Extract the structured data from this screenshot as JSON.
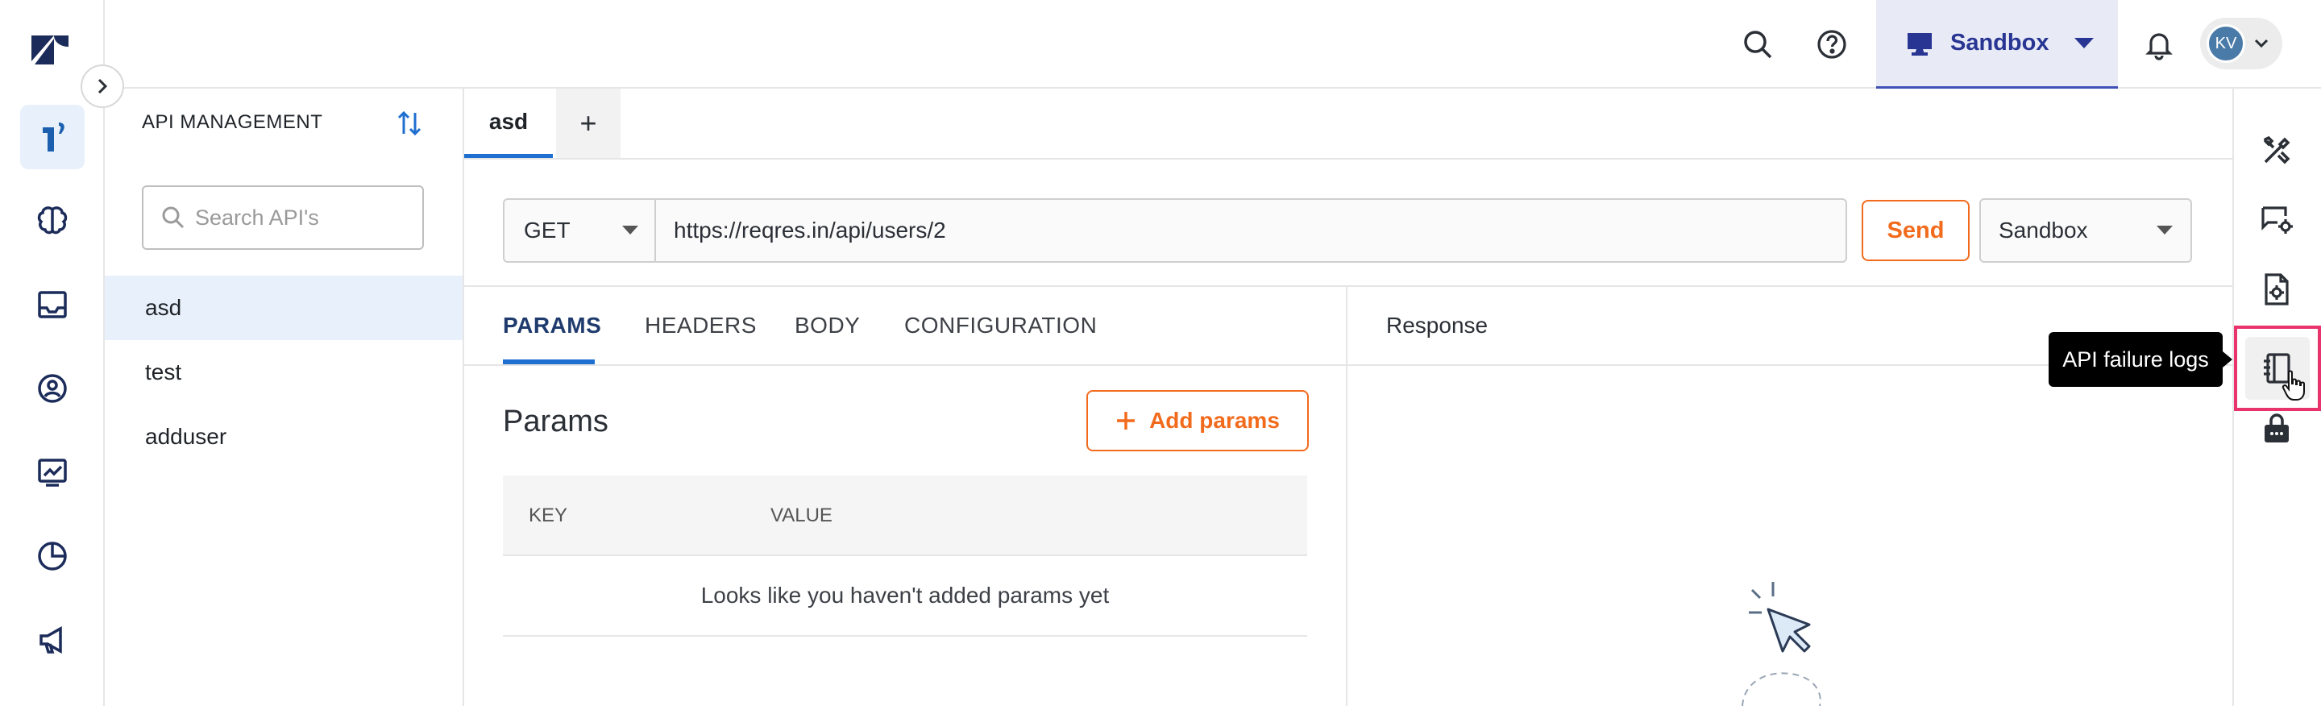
{
  "topbar": {
    "environment_label": "Sandbox",
    "avatar_initials": "KV"
  },
  "api_panel": {
    "title": "API MANAGEMENT",
    "search_placeholder": "Search API's",
    "items": [
      {
        "label": "asd",
        "selected": true
      },
      {
        "label": "test",
        "selected": false
      },
      {
        "label": "adduser",
        "selected": false
      }
    ]
  },
  "tabs": {
    "items": [
      {
        "label": "asd"
      }
    ],
    "add_label": "+"
  },
  "request": {
    "method": "GET",
    "url": "https://reqres.in/api/users/2",
    "send_label": "Send",
    "environment": "Sandbox"
  },
  "subtabs": [
    "PARAMS",
    "HEADERS",
    "BODY",
    "CONFIGURATION"
  ],
  "params": {
    "title": "Params",
    "add_label": "Add params",
    "col_key": "KEY",
    "col_value": "VALUE",
    "empty_text": "Looks like you haven't added params yet"
  },
  "response": {
    "title": "Response"
  },
  "tooltip": {
    "text": "API failure logs"
  },
  "colors": {
    "accent_orange": "#f26b1d",
    "active_blue": "#1f6fd1",
    "brand_navy": "#1c2c5a",
    "sandbox_bg": "#e8eaf6",
    "highlight_pink": "#e8336d"
  },
  "icons": {
    "left_rail": [
      "zendesk-logo-icon",
      "one-logo-icon",
      "brain-icon",
      "inbox-icon",
      "user-circle-icon",
      "analytics-icon",
      "pie-chart-icon",
      "megaphone-icon"
    ],
    "right_rail": [
      "tools-icon",
      "chat-settings-icon",
      "file-settings-icon",
      "api-logs-icon",
      "lock-bag-icon"
    ]
  }
}
